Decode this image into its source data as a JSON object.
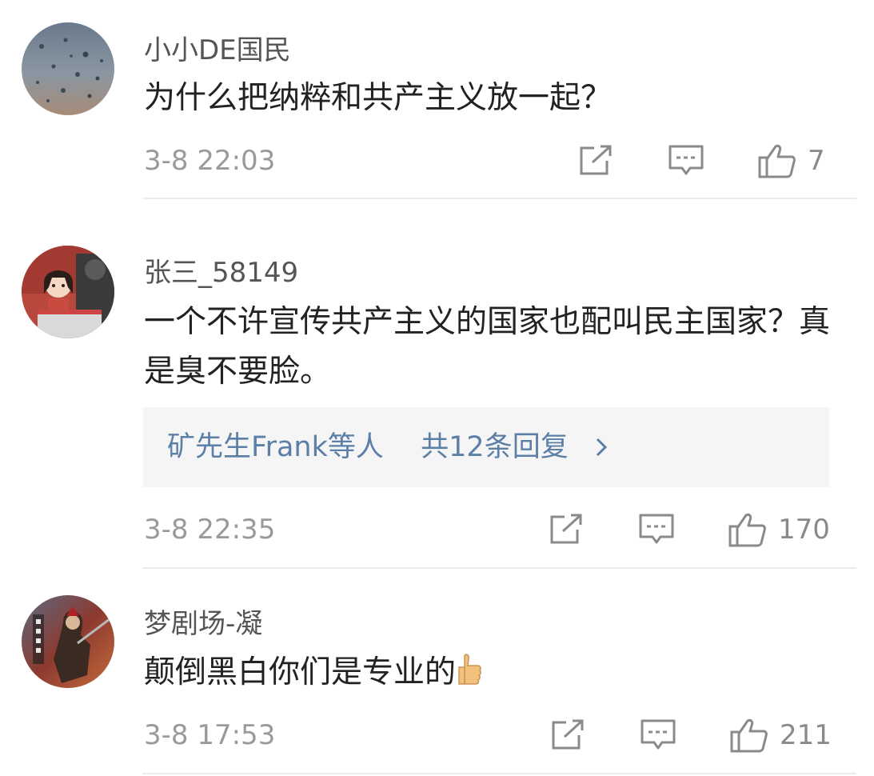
{
  "comments": [
    {
      "username": "小小DE国民",
      "text": "为什么把纳粹和共产主义放一起？",
      "timestamp": "3-8 22:03",
      "likes": "7",
      "avatar": "rain-drops-avatar"
    },
    {
      "username": "张三_58149",
      "text": "一个不许宣传共产主义的国家也配叫民主国家？真是臭不要脸。",
      "replies": {
        "who": "矿先生Frank等人",
        "count_text": "共12条回复"
      },
      "timestamp": "3-8 22:35",
      "likes": "170",
      "avatar": "cartoon-girl-avatar"
    },
    {
      "username": "梦剧场-凝",
      "text": "颠倒黑白你们是专业的",
      "emoji": "thumbs-up-emoji",
      "timestamp": "3-8 17:53",
      "likes": "211",
      "avatar": "warrior-avatar"
    }
  ],
  "icons": {
    "share": "share-icon",
    "reply": "reply-icon",
    "like": "like-icon",
    "chevron": "chevron-right-icon"
  },
  "colors": {
    "username": "#555555",
    "body_text": "#222222",
    "meta_text": "#9a9a9a",
    "reply_link": "#5b7fa6",
    "reply_box_bg": "#f5f5f5",
    "icon_stroke": "#8a8a8a",
    "divider": "#ececec"
  }
}
